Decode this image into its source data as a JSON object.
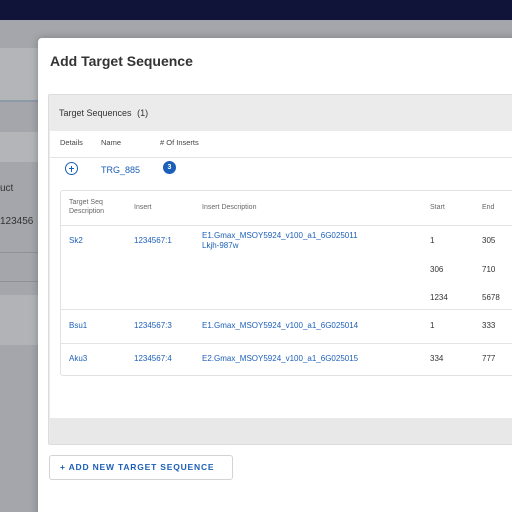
{
  "background": {
    "partial_text_1": "uct",
    "partial_text_2": "123456"
  },
  "modal": {
    "title": "Add Target Sequence",
    "panel": {
      "title": "Target Sequences",
      "count": "(1)",
      "columns": [
        "Details",
        "Name",
        "# Of Inserts"
      ],
      "sequence": {
        "name": "TRG_885",
        "insert_count": "3",
        "expand_icon": "plus-circle-icon"
      },
      "inner_columns": {
        "target_seq_line1": "Target Seq",
        "target_seq_line2": "Description",
        "insert": "Insert",
        "insert_description": "Insert Description",
        "start": "Start",
        "end": "End"
      },
      "rows": [
        {
          "target": "Sk2",
          "insert": "1234567:1",
          "description": "E1.Gmax_MSOY5924_v100_a1_6G025011",
          "description2": "Lkjh-987w",
          "ranges": [
            {
              "start": "1",
              "end": "305"
            },
            {
              "start": "306",
              "end": "710"
            },
            {
              "start": "1234",
              "end": "5678"
            }
          ]
        },
        {
          "target": "Bsu1",
          "insert": "1234567:3",
          "description": "E1.Gmax_MSOY5924_v100_a1_6G025014",
          "ranges": [
            {
              "start": "1",
              "end": "333"
            }
          ]
        },
        {
          "target": "Aku3",
          "insert": "1234567:4",
          "description": "E2.Gmax_MSOY5924_v100_a1_6G025015",
          "ranges": [
            {
              "start": "334",
              "end": "777"
            }
          ]
        }
      ]
    },
    "add_button_label": "+ ADD NEW TARGET SEQUENCE"
  },
  "colors": {
    "accent": "#1c5fb8",
    "topbar": "#0f1438",
    "overlay": "#a4a6ab"
  }
}
